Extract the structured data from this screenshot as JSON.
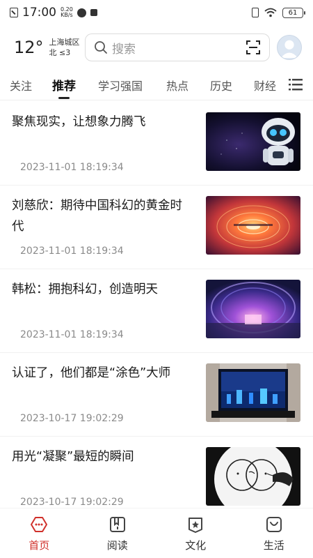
{
  "status_bar": {
    "time": "17:00",
    "net_speed_value": "0.20",
    "net_speed_unit": "KB/s",
    "battery": "61"
  },
  "header": {
    "temperature": "12°",
    "location": "上海城区",
    "wind": "北 ≤3",
    "search_placeholder": "搜索"
  },
  "tabs": [
    {
      "label": "关注"
    },
    {
      "label": "推荐"
    },
    {
      "label": "学习强国"
    },
    {
      "label": "热点"
    },
    {
      "label": "历史"
    },
    {
      "label": "财经"
    }
  ],
  "articles": [
    {
      "title": "聚焦现实，让想象力腾飞",
      "date": "2023-11-01 18:19:34"
    },
    {
      "title": "刘慈欣：期待中国科幻的黄金时代",
      "date": "2023-11-01 18:19:34"
    },
    {
      "title": "韩松：拥抱科幻，创造明天",
      "date": "2023-11-01 18:19:34"
    },
    {
      "title": "认证了，他们都是“涂色”大师",
      "date": "2023-10-17 19:02:29"
    },
    {
      "title": "用光“凝聚”最短的瞬间",
      "date": "2023-10-17 19:02:29"
    }
  ],
  "bottom_nav": [
    {
      "label": "首页"
    },
    {
      "label": "阅读"
    },
    {
      "label": "文化"
    },
    {
      "label": "生活"
    }
  ],
  "colors": {
    "accent": "#d0302b",
    "text": "#1a1a1a",
    "muted": "#8a8a8a"
  }
}
